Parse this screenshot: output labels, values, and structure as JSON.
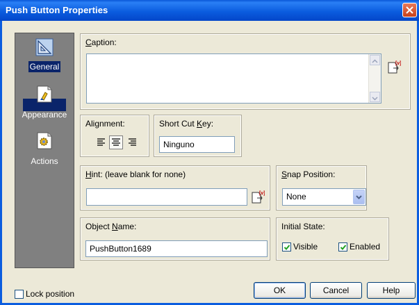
{
  "window": {
    "title": "Push Button Properties"
  },
  "nav": {
    "items": [
      {
        "label": "General",
        "icon": "triangle-ruler-icon",
        "selected": true
      },
      {
        "label": "Appearance",
        "icon": "paint-page-icon",
        "selected": false
      },
      {
        "label": "Actions",
        "icon": "gear-page-icon",
        "selected": false
      }
    ]
  },
  "caption": {
    "label_u": "C",
    "label_rest": "aption:",
    "value": ""
  },
  "alignment": {
    "label": "Alignment:",
    "options": [
      "align-left-icon",
      "align-center-icon",
      "align-right-icon"
    ],
    "selected": "align-center-icon"
  },
  "shortcut": {
    "label_pre": "Short Cut ",
    "label_u": "K",
    "label_rest": "ey:",
    "value": "Ninguno"
  },
  "hint": {
    "label_u": "H",
    "label_rest": "int: (leave blank for none)",
    "value": ""
  },
  "snap": {
    "label_u": "S",
    "label_rest": "nap Position:",
    "value": "None"
  },
  "object_name": {
    "label_pre": "Object ",
    "label_u": "N",
    "label_rest": "ame:",
    "value": "PushButton1689"
  },
  "initial_state": {
    "label": "Initial State:",
    "visible_label": "Visible",
    "visible_checked": true,
    "enabled_label": "Enabled",
    "enabled_checked": true
  },
  "lock_position": {
    "label": "Lock position",
    "checked": false
  },
  "buttons": {
    "ok": "OK",
    "cancel": "Cancel",
    "help": "Help"
  },
  "colors": {
    "title_bar": "#0b5ddf",
    "nav_bg": "#808080",
    "nav_selected": "#0a246a",
    "dialog_bg": "#ece9d8"
  }
}
